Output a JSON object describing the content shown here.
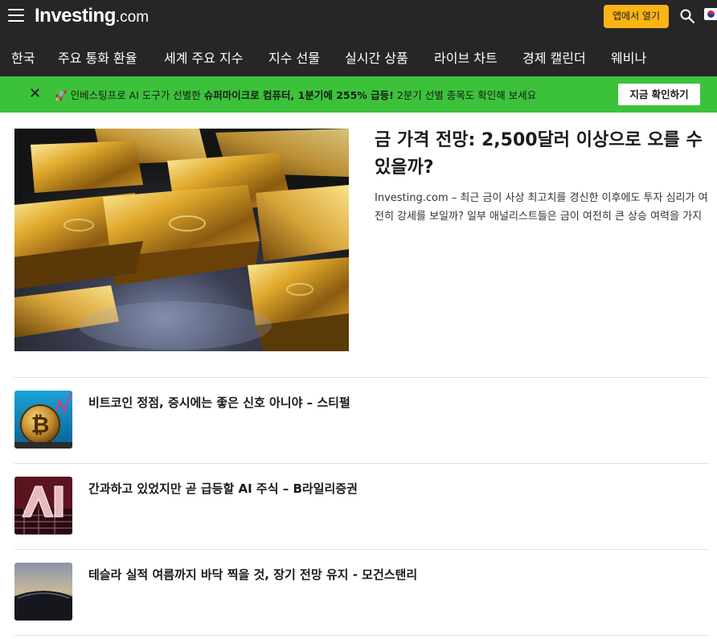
{
  "header": {
    "logo_main": "Investing",
    "logo_suffix": ".com",
    "app_button": "앱에서 열기",
    "menu_icon": "hamburger-menu-icon",
    "search_icon": "search-icon",
    "flag_icon": "korea-flag-icon"
  },
  "nav": {
    "items": [
      "한국",
      "주요 통화 환율",
      "세계 주요 지수",
      "지수 선물",
      "실시간 상품",
      "라이브 차트",
      "경제 캘린더",
      "웨비나"
    ]
  },
  "promo": {
    "icon": "rocket-icon",
    "text_1": "인베스팅프로 AI 도구가 선별한 ",
    "text_bold_1": "슈퍼마이크로 컴퓨터, 1분기에 255% 급등!",
    "text_2": " 2분기 선별 종목도 확인해 보세요",
    "button": "지금 확인하기",
    "close_icon": "close-icon",
    "background_color": "#3cc23a"
  },
  "lead_story": {
    "title": "금 가격 전망: 2,500달러 이상으로 오를 수 있을까?",
    "summary": "Investing.com – 최근 금이 사상 최고치를 경신한 이후에도 투자 심리가 여전히 강세를 보일까? 일부 애널리스트들은 금이 여전히 큰 상승 여력을 가지고 있다고 봅니다...",
    "image": "gold-bars-photo"
  },
  "stories": [
    {
      "title": "비트코인 정점, 증시에는 좋은 신호 아니야 – 스티펄",
      "image": "bitcoin-coin-photo"
    },
    {
      "title": "간과하고 있었지만 곧 급등할 AI 주식 – B라일리증권",
      "image": "ai-chip-photo"
    },
    {
      "title": "테슬라 실적 여름까지 바닥 찍을 것, 장기 전망 유지 - 모건스탠리",
      "image": "tesla-car-photo"
    }
  ],
  "colors": {
    "header_bg": "#262626",
    "accent": "#fbb416",
    "promo_green": "#3cc23a"
  }
}
